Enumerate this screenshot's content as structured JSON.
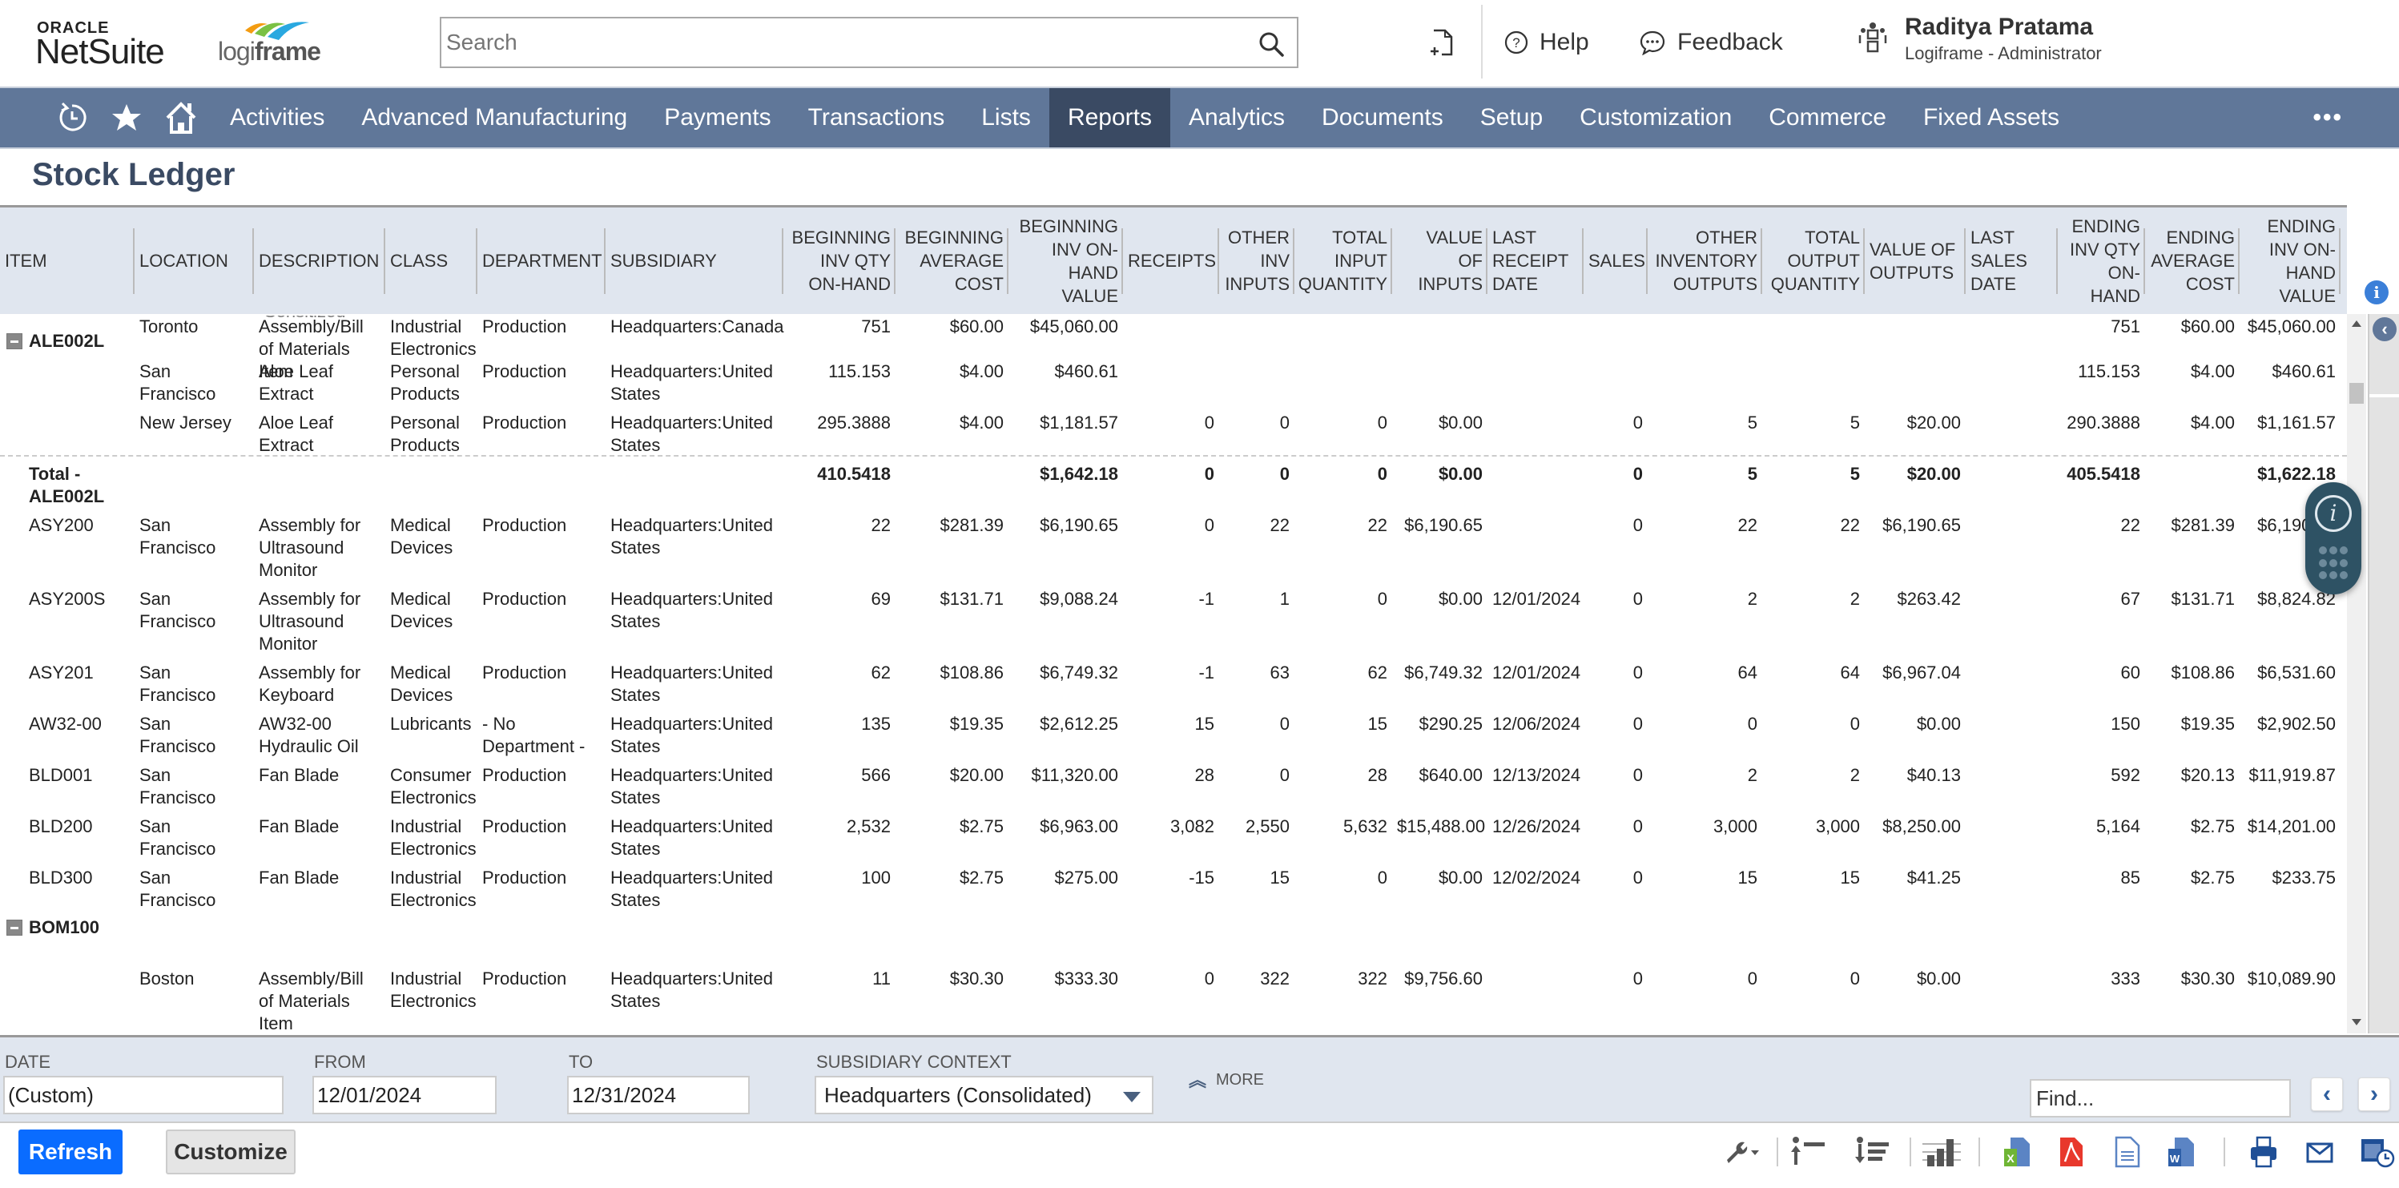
{
  "header": {
    "oracle_label": "ORACLE",
    "netsuite_label": "NetSuite",
    "logiframe_light": "logi",
    "logiframe_bold": "frame",
    "search_placeholder": "Search",
    "help_label": "Help",
    "feedback_label": "Feedback",
    "user_name": "Raditya Pratama",
    "user_role": "Logiframe - Administrator"
  },
  "nav": {
    "items": [
      {
        "label": "Activities"
      },
      {
        "label": "Advanced Manufacturing"
      },
      {
        "label": "Payments"
      },
      {
        "label": "Transactions"
      },
      {
        "label": "Lists"
      },
      {
        "label": "Reports",
        "active": true
      },
      {
        "label": "Analytics"
      },
      {
        "label": "Documents"
      },
      {
        "label": "Setup"
      },
      {
        "label": "Customization"
      },
      {
        "label": "Commerce"
      },
      {
        "label": "Fixed Assets"
      }
    ],
    "more_label": "•••"
  },
  "page": {
    "title": "Stock Ledger"
  },
  "table": {
    "columns": [
      {
        "key": "item",
        "label": "ITEM"
      },
      {
        "key": "location",
        "label": "LOCATION"
      },
      {
        "key": "description",
        "label": "DESCRIPTION"
      },
      {
        "key": "class",
        "label": "CLASS"
      },
      {
        "key": "department",
        "label": "DEPARTMENT"
      },
      {
        "key": "subsidiary",
        "label": "SUBSIDIARY"
      },
      {
        "key": "beg_qty",
        "label": "BEGINNING INV QTY ON-HAND"
      },
      {
        "key": "beg_avg",
        "label": "BEGINNING AVERAGE COST"
      },
      {
        "key": "beg_val",
        "label": "BEGINNING INV ON-HAND VALUE"
      },
      {
        "key": "receipts",
        "label": "RECEIPTS"
      },
      {
        "key": "other_in",
        "label": "OTHER INV INPUTS"
      },
      {
        "key": "total_in",
        "label": "TOTAL INPUT QUANTITY"
      },
      {
        "key": "val_in",
        "label": "VALUE OF INPUTS"
      },
      {
        "key": "last_receipt",
        "label": "LAST RECEIPT DATE"
      },
      {
        "key": "sales",
        "label": "SALES"
      },
      {
        "key": "other_out",
        "label": "OTHER INVENTORY OUTPUTS"
      },
      {
        "key": "total_out",
        "label": "TOTAL OUTPUT QUANTITY"
      },
      {
        "key": "val_out",
        "label": "VALUE OF OUTPUTS"
      },
      {
        "key": "last_sales",
        "label": "LAST SALES DATE"
      },
      {
        "key": "end_qty",
        "label": "ENDING INV QTY ON-HAND"
      },
      {
        "key": "end_avg",
        "label": "ENDING AVERAGE COST"
      },
      {
        "key": "end_val",
        "label": "ENDING INV ON-HAND VALUE"
      }
    ],
    "partial_top_text": "Sensitized",
    "rows": [
      {
        "type": "group",
        "item": "ALE002L"
      },
      {
        "type": "detail",
        "item": "",
        "location": "San Francisco",
        "description": "Aloe Leaf Extract",
        "class": "Personal Products",
        "department": "Production",
        "subsidiary": "Headquarters:United States",
        "beg_qty": "115.153",
        "beg_avg": "$4.00",
        "beg_val": "$460.61",
        "receipts": "",
        "other_in": "",
        "total_in": "",
        "val_in": "",
        "last_receipt": "",
        "sales": "",
        "other_out": "",
        "total_out": "",
        "val_out": "",
        "last_sales": "",
        "end_qty": "115.153",
        "end_avg": "$4.00",
        "end_val": "$460.61"
      },
      {
        "type": "detail",
        "item": "",
        "location": "New Jersey",
        "description": "Aloe Leaf Extract",
        "class": "Personal Products",
        "department": "Production",
        "subsidiary": "Headquarters:United States",
        "beg_qty": "295.3888",
        "beg_avg": "$4.00",
        "beg_val": "$1,181.57",
        "receipts": "0",
        "other_in": "0",
        "total_in": "0",
        "val_in": "$0.00",
        "last_receipt": "",
        "sales": "0",
        "other_out": "5",
        "total_out": "5",
        "val_out": "$20.00",
        "last_sales": "",
        "end_qty": "290.3888",
        "end_avg": "$4.00",
        "end_val": "$1,161.57"
      },
      {
        "type": "total",
        "item": "Total - ALE002L",
        "location": "",
        "description": "",
        "class": "",
        "department": "",
        "subsidiary": "",
        "beg_qty": "410.5418",
        "beg_avg": "",
        "beg_val": "$1,642.18",
        "receipts": "0",
        "other_in": "0",
        "total_in": "0",
        "val_in": "$0.00",
        "last_receipt": "",
        "sales": "0",
        "other_out": "5",
        "total_out": "5",
        "val_out": "$20.00",
        "last_sales": "",
        "end_qty": "405.5418",
        "end_avg": "",
        "end_val": "$1,622.18"
      },
      {
        "type": "detail",
        "item": "ASY200",
        "location": "San Francisco",
        "description": "Assembly for Ultrasound Monitor",
        "class": "Medical Devices",
        "department": "Production",
        "subsidiary": "Headquarters:United States",
        "beg_qty": "22",
        "beg_avg": "$281.39",
        "beg_val": "$6,190.65",
        "receipts": "0",
        "other_in": "22",
        "total_in": "22",
        "val_in": "$6,190.65",
        "last_receipt": "",
        "sales": "0",
        "other_out": "22",
        "total_out": "22",
        "val_out": "$6,190.65",
        "last_sales": "",
        "end_qty": "22",
        "end_avg": "$281.39",
        "end_val": "$6,190.65"
      },
      {
        "type": "detail",
        "item": "ASY200S",
        "location": "San Francisco",
        "description": "Assembly for Ultrasound Monitor",
        "class": "Medical Devices",
        "department": "Production",
        "subsidiary": "Headquarters:United States",
        "beg_qty": "69",
        "beg_avg": "$131.71",
        "beg_val": "$9,088.24",
        "receipts": "-1",
        "other_in": "1",
        "total_in": "0",
        "val_in": "$0.00",
        "last_receipt": "12/01/2024",
        "sales": "0",
        "other_out": "2",
        "total_out": "2",
        "val_out": "$263.42",
        "last_sales": "",
        "end_qty": "67",
        "end_avg": "$131.71",
        "end_val": "$8,824.82"
      },
      {
        "type": "detail",
        "item": "ASY201",
        "location": "San Francisco",
        "description": "Assembly for Keyboard",
        "class": "Medical Devices",
        "department": "Production",
        "subsidiary": "Headquarters:United States",
        "beg_qty": "62",
        "beg_avg": "$108.86",
        "beg_val": "$6,749.32",
        "receipts": "-1",
        "other_in": "63",
        "total_in": "62",
        "val_in": "$6,749.32",
        "last_receipt": "12/01/2024",
        "sales": "0",
        "other_out": "64",
        "total_out": "64",
        "val_out": "$6,967.04",
        "last_sales": "",
        "end_qty": "60",
        "end_avg": "$108.86",
        "end_val": "$6,531.60"
      },
      {
        "type": "detail",
        "item": "AW32-00",
        "location": "San Francisco",
        "description": "AW32-00 Hydraulic Oil",
        "class": "Lubricants",
        "department": "- No Department -",
        "subsidiary": "Headquarters:United States",
        "beg_qty": "135",
        "beg_avg": "$19.35",
        "beg_val": "$2,612.25",
        "receipts": "15",
        "other_in": "0",
        "total_in": "15",
        "val_in": "$290.25",
        "last_receipt": "12/06/2024",
        "sales": "0",
        "other_out": "0",
        "total_out": "0",
        "val_out": "$0.00",
        "last_sales": "",
        "end_qty": "150",
        "end_avg": "$19.35",
        "end_val": "$2,902.50"
      },
      {
        "type": "detail",
        "item": "BLD001",
        "location": "San Francisco",
        "description": "Fan Blade",
        "class": "Consumer Electronics",
        "department": "Production",
        "subsidiary": "Headquarters:United States",
        "beg_qty": "566",
        "beg_avg": "$20.00",
        "beg_val": "$11,320.00",
        "receipts": "28",
        "other_in": "0",
        "total_in": "28",
        "val_in": "$640.00",
        "last_receipt": "12/13/2024",
        "sales": "0",
        "other_out": "2",
        "total_out": "2",
        "val_out": "$40.13",
        "last_sales": "",
        "end_qty": "592",
        "end_avg": "$20.13",
        "end_val": "$11,919.87"
      },
      {
        "type": "detail",
        "item": "BLD200",
        "location": "San Francisco",
        "description": "Fan Blade",
        "class": "Industrial Electronics",
        "department": "Production",
        "subsidiary": "Headquarters:United States",
        "beg_qty": "2,532",
        "beg_avg": "$2.75",
        "beg_val": "$6,963.00",
        "receipts": "3,082",
        "other_in": "2,550",
        "total_in": "5,632",
        "val_in": "$15,488.00",
        "last_receipt": "12/26/2024",
        "sales": "0",
        "other_out": "3,000",
        "total_out": "3,000",
        "val_out": "$8,250.00",
        "last_sales": "",
        "end_qty": "5,164",
        "end_avg": "$2.75",
        "end_val": "$14,201.00"
      },
      {
        "type": "detail",
        "item": "BLD300",
        "location": "San Francisco",
        "description": "Fan Blade",
        "class": "Industrial Electronics",
        "department": "Production",
        "subsidiary": "Headquarters:United States",
        "beg_qty": "100",
        "beg_avg": "$2.75",
        "beg_val": "$275.00",
        "receipts": "-15",
        "other_in": "15",
        "total_in": "0",
        "val_in": "$0.00",
        "last_receipt": "12/02/2024",
        "sales": "0",
        "other_out": "15",
        "total_out": "15",
        "val_out": "$41.25",
        "last_sales": "",
        "end_qty": "85",
        "end_avg": "$2.75",
        "end_val": "$233.75"
      },
      {
        "type": "group",
        "item": "BOM100"
      },
      {
        "type": "detail",
        "item": "",
        "location": "Boston",
        "description": "Assembly/Bill of Materials Item",
        "class": "Industrial Electronics",
        "department": "Production",
        "subsidiary": "Headquarters:United States",
        "beg_qty": "11",
        "beg_avg": "$30.30",
        "beg_val": "$333.30",
        "receipts": "0",
        "other_in": "322",
        "total_in": "322",
        "val_in": "$9,756.60",
        "last_receipt": "",
        "sales": "0",
        "other_out": "0",
        "total_out": "0",
        "val_out": "$0.00",
        "last_sales": "",
        "end_qty": "333",
        "end_avg": "$30.30",
        "end_val": "$10,089.90"
      },
      {
        "type": "detail",
        "item": "",
        "location": "Toronto",
        "description": "Assembly/Bill of Materials Item",
        "class": "Industrial Electronics",
        "department": "Production",
        "subsidiary": "Headquarters:Canada",
        "beg_qty": "751",
        "beg_avg": "$60.00",
        "beg_val": "$45,060.00",
        "receipts": "",
        "other_in": "",
        "total_in": "",
        "val_in": "",
        "last_receipt": "",
        "sales": "",
        "other_out": "",
        "total_out": "",
        "val_out": "",
        "last_sales": "",
        "end_qty": "751",
        "end_avg": "$60.00",
        "end_val": "$45,060.00"
      }
    ]
  },
  "filters": {
    "date_label": "DATE",
    "date_value": "(Custom)",
    "from_label": "FROM",
    "from_value": "12/01/2024",
    "to_label": "TO",
    "to_value": "12/31/2024",
    "subsidiary_label": "SUBSIDIARY CONTEXT",
    "subsidiary_value": "Headquarters (Consolidated)",
    "more_label": "MORE",
    "find_placeholder": "Find...",
    "prev_label": "‹",
    "next_label": "›"
  },
  "toolbar": {
    "refresh_label": "Refresh",
    "customize_label": "Customize"
  },
  "colors": {
    "nav_bg": "#607799",
    "nav_active": "#3a4a63",
    "header_bg": "#e0e6ef",
    "primary_button": "#0a6cff"
  }
}
